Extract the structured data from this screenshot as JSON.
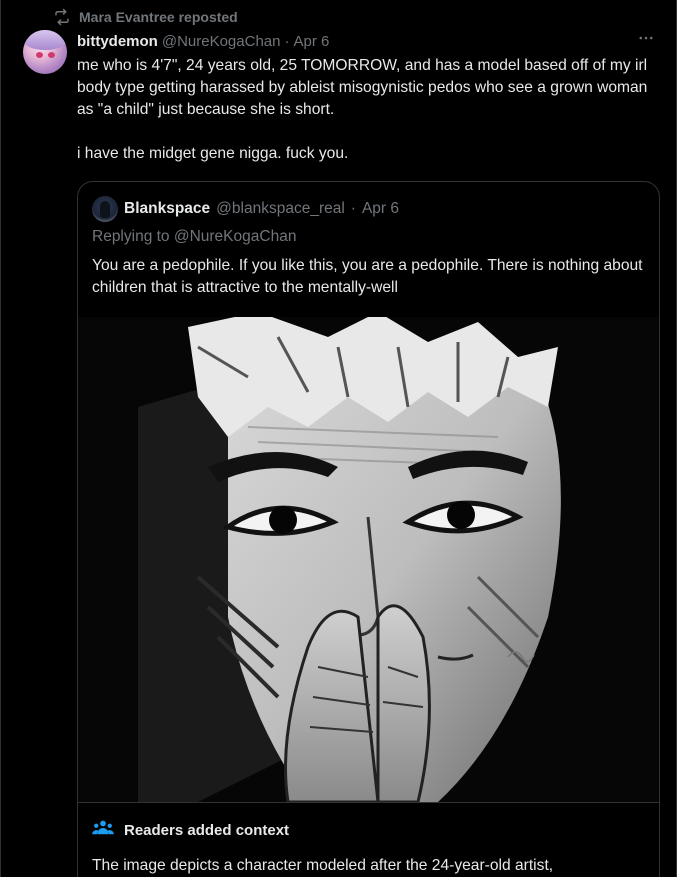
{
  "repost": {
    "text": "Mara Evantree reposted",
    "icon": "repost-icon"
  },
  "tweet": {
    "display_name": "bittydemon",
    "handle": "@NureKogaChan",
    "separator": "·",
    "date": "Apr 6",
    "more_icon": "more-horizontal-icon",
    "text_para1": "me who is 4'7\", 24 years old, 25 TOMORROW, and has a model based off of my irl body type getting harassed by ableist misogynistic pedos who see a grown woman as \"a child\" just because she is short.",
    "text_para2": "i have the midget gene nigga. fuck you."
  },
  "quote": {
    "display_name": "Blankspace",
    "handle": "@blankspace_real",
    "separator": "·",
    "date": "Apr 6",
    "replying_to": "Replying to @NureKogaChan",
    "text": "You are a pedophile. If you like this, you are a pedophile. There is nothing about children that is attractive to the mentally-well",
    "image_description_icon": "manga-portrait-image"
  },
  "context": {
    "icon": "people-icon",
    "title": "Readers added context",
    "body": "The image depicts a character modeled after the 24-year-old artist,"
  },
  "colors": {
    "background": "#000000",
    "text": "#e7e9ea",
    "muted": "#71767b",
    "border": "#2f3336",
    "context_icon": "#1d9bf0"
  }
}
